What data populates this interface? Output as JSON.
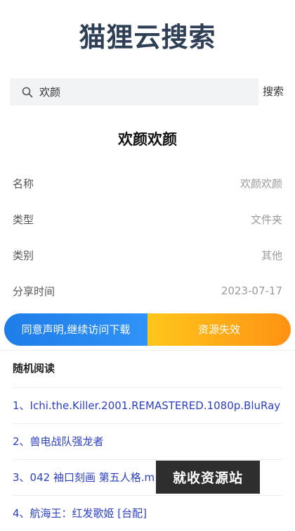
{
  "header": {
    "title": "猫狸云搜索"
  },
  "search": {
    "value": "欢颜",
    "button_label": "搜索"
  },
  "detail": {
    "title": "欢颜欢颜",
    "rows": [
      {
        "label": "名称",
        "value": "欢颜欢颜"
      },
      {
        "label": "类型",
        "value": "文件夹"
      },
      {
        "label": "类别",
        "value": "其他"
      },
      {
        "label": "分享时间",
        "value": "2023-07-17"
      }
    ]
  },
  "actions": {
    "agree_label": "同意声明,继续访问下载",
    "invalid_label": "资源失效"
  },
  "random": {
    "heading": "随机阅读",
    "items": [
      "1、Ichi.the.Killer.2001.REMASTERED.1080p.BluRay",
      "2、兽电战队强龙者",
      "3、042 袖口刻画 第五人格.m",
      "4、航海王：红发歌姬 [台配]"
    ]
  },
  "watermark": {
    "text": "就收资源站"
  },
  "colors": {
    "title": "#2f3f55",
    "link": "#2b3fc0",
    "agree": "#1f7de8",
    "invalid": "#ff9214"
  }
}
